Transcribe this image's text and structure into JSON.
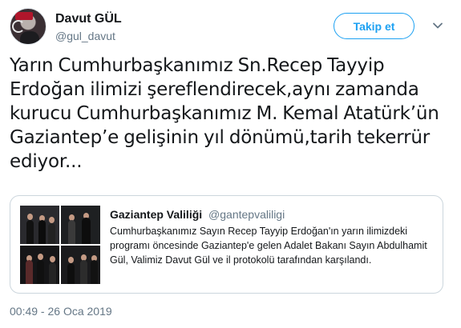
{
  "author": {
    "display_name": "Davut GÜL",
    "screen_name": "@gul_davut",
    "avatar_icon": "profile-avatar"
  },
  "follow_button": {
    "label": "Takip et",
    "color": "#1da1f2"
  },
  "menu": {
    "icon": "chevron-down-icon"
  },
  "tweet": {
    "text": "Yarın Cumhurbaşkanımız Sn.Recep Tayyip Erdoğan ilimizi şereflendirecek,aynı zamanda kurucu Cumhurbaşkanımız M. Kemal Atatürk’ün Gaziantep’e gelişinin yıl dönümü,tarih tekerrür ediyor..."
  },
  "quoted_tweet": {
    "display_name": "Gaziantep Valiliği",
    "screen_name": "@gantepvaliligi",
    "text": "Cumhurbaşkanımız Sayın Recep Tayyip Erdoğan'ın yarın ilimizdeki programı öncesinde Gaziantep'e gelen Adalet Bakanı Sayın Abdulhamit Gül, Valimiz Davut Gül ve il protokolü tarafından karşılandı.",
    "media_count": 4
  },
  "timestamp": "00:49 - 26 Oca 2019",
  "colors": {
    "text_primary": "#14171a",
    "text_secondary": "#657786",
    "border": "#ccd6dd",
    "accent": "#1da1f2"
  }
}
